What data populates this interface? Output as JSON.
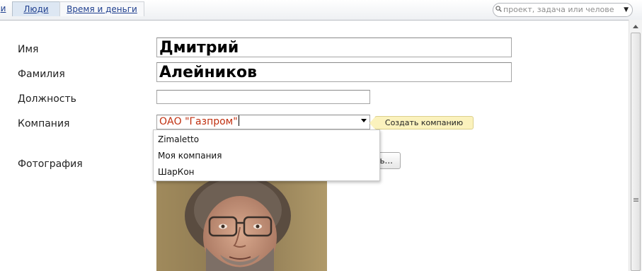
{
  "nav": {
    "tabs": [
      {
        "label": "и"
      },
      {
        "label": "Люди"
      },
      {
        "label": "Время и деньги"
      }
    ],
    "search_placeholder": "проект, задача или челове"
  },
  "form": {
    "first_name_label": "Имя",
    "first_name_value": "Дмитрий",
    "last_name_label": "Фамилия",
    "last_name_value": "Алейников",
    "position_label": "Должность",
    "position_value": "",
    "company_label": "Компания",
    "company_value": "ОАО \"Газпром\"",
    "create_company_button": "Создать компанию",
    "company_options": [
      "Zimaletto",
      "Моя компания",
      "ШарКон"
    ],
    "photo_label": "Фотография",
    "upload_button_visible": "ь..."
  },
  "colors": {
    "link": "#1f3f8f",
    "active_tab_bg": "#dde7f3",
    "company_text": "#c03010",
    "create_button_bg": "#fbf2bd"
  }
}
